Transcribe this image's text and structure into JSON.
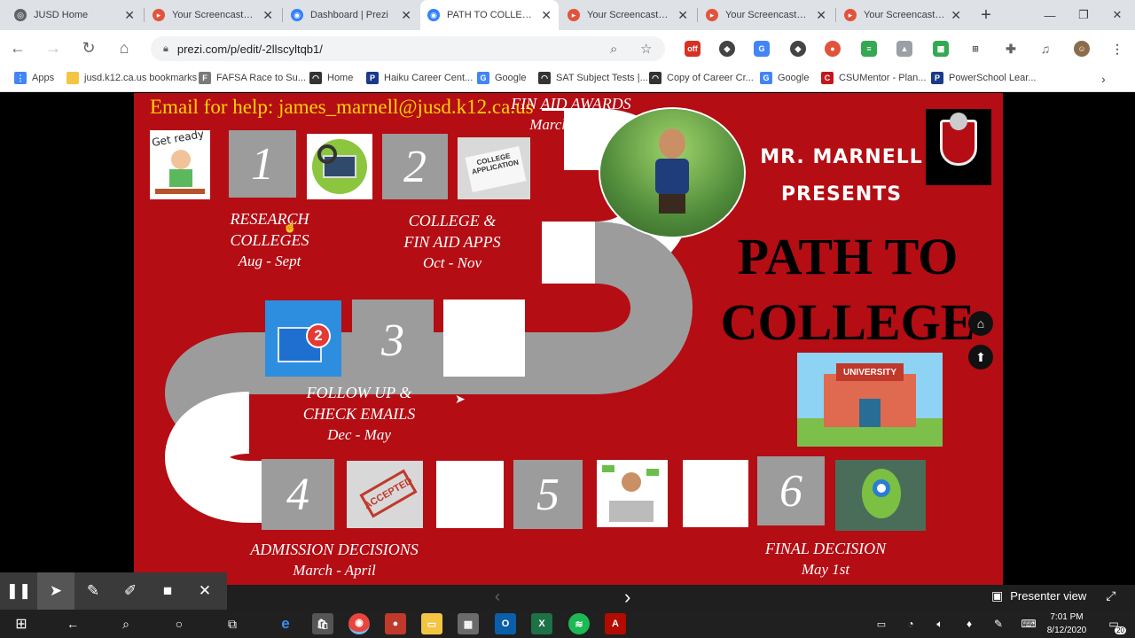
{
  "browser": {
    "tabs": [
      {
        "title": "JUSD Home",
        "favicon": "jusd-icon",
        "color": "#5f6368"
      },
      {
        "title": "Your Screencasts - Sc",
        "favicon": "screencast-icon",
        "color": "#e2533c"
      },
      {
        "title": "Dashboard | Prezi",
        "favicon": "prezi-icon",
        "color": "#3181ff"
      },
      {
        "title": "PATH TO COLLEGE | P",
        "favicon": "prezi-icon",
        "color": "#3181ff"
      },
      {
        "title": "Your Screencasts - Sc",
        "favicon": "screencast-icon",
        "color": "#e2533c"
      },
      {
        "title": "Your Screencasts - Sc",
        "favicon": "screencast-icon",
        "color": "#e2533c"
      },
      {
        "title": "Your Screencasts - Sc",
        "favicon": "screencast-icon",
        "color": "#e2533c"
      }
    ],
    "url": "prezi.com/p/edit/-2llscyltqb1/",
    "bookmarks": [
      {
        "label": "Apps",
        "icon": "apps-grid-icon",
        "color": "#4285f4"
      },
      {
        "label": "jusd.k12.ca.us bookmarks",
        "icon": "folder-icon",
        "color": "#f4c542"
      },
      {
        "label": "FAFSA Race to Su...",
        "icon": "fafsa-icon",
        "color": "#7a7a7a"
      },
      {
        "label": "Home",
        "icon": "home-bookmark-icon",
        "color": "#333333"
      },
      {
        "label": "Haiku Career Cent...",
        "icon": "haiku-icon",
        "color": "#1a3a8a"
      },
      {
        "label": "Google",
        "icon": "google-icon",
        "color": "#4285f4"
      },
      {
        "label": "SAT Subject Tests |...",
        "icon": "sat-icon",
        "color": "#333333"
      },
      {
        "label": "Copy of Career Cr...",
        "icon": "career-icon",
        "color": "#333333"
      },
      {
        "label": "Google",
        "icon": "google-icon",
        "color": "#4285f4"
      },
      {
        "label": "CSUMentor - Plan...",
        "icon": "csu-icon",
        "color": "#c4161c"
      },
      {
        "label": "PowerSchool Lear...",
        "icon": "powerschool-icon",
        "color": "#1a3a8a"
      }
    ]
  },
  "slide": {
    "email_help": "Email for help: james_marnell@jusd.k12.ca.us",
    "presenter_line1": "MR. MARNELL",
    "presenter_line2": "PRESENTS",
    "title_line1": "PATH TO",
    "title_line2": "COLLEGE",
    "steps": [
      {
        "number": "1",
        "line1": "RESEARCH",
        "line2": "COLLEGES",
        "dates": "Aug - Sept"
      },
      {
        "number": "2",
        "line1": "COLLEGE &",
        "line2": "FIN AID APPS",
        "dates": "Oct - Nov"
      },
      {
        "number": "3",
        "line1": "FOLLOW UP &",
        "line2": "CHECK EMAILS",
        "dates": "Dec - May"
      },
      {
        "number": "4",
        "line1": "ADMISSION DECISIONS",
        "dates": "March - April"
      },
      {
        "number": "5",
        "line1": "FIN AID AWARDS",
        "dates": "March - April"
      },
      {
        "number": "6",
        "line1": "FINAL DECISION",
        "dates": "May 1st"
      }
    ],
    "image_text": {
      "get_ready": "Get ready",
      "application": "COLLEGE APPLICATION",
      "mail_badge": "2",
      "accepted": "ACCEPTED",
      "university": "UNIVERSITY"
    },
    "colors": {
      "background": "#b40d14",
      "step_box": "#9c9c9c",
      "email_text": "#ffd400"
    }
  },
  "presenter_controls": {
    "presenter_view_label": "Presenter view"
  },
  "taskbar": {
    "time": "7:01 PM",
    "date": "8/12/2020",
    "notification_count": "20"
  }
}
